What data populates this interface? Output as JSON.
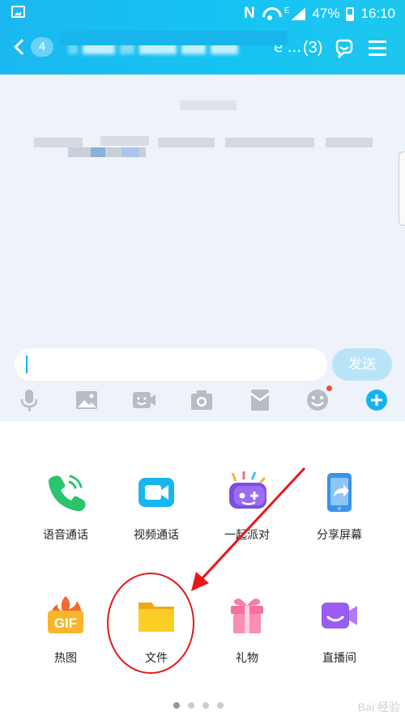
{
  "status_bar": {
    "battery": "47%",
    "time": "16:10",
    "network": "N",
    "signal_type": "E"
  },
  "header": {
    "back_count": "4",
    "title_suffix": "e ...",
    "member_count": "(3)"
  },
  "input": {
    "placeholder": "",
    "send_label": "发送"
  },
  "toolbar": {
    "icons": [
      "microphone-icon",
      "image-icon",
      "video-chat-icon",
      "camera-icon",
      "red-packet-icon",
      "emoji-icon",
      "plus-icon"
    ]
  },
  "panel": {
    "row1": [
      {
        "label": "语音通话",
        "icon": "phone-icon"
      },
      {
        "label": "视频通话",
        "icon": "video-call-icon"
      },
      {
        "label": "一起派对",
        "icon": "party-icon"
      },
      {
        "label": "分享屏幕",
        "icon": "screen-share-icon"
      }
    ],
    "row2": [
      {
        "label": "热图",
        "icon": "gif-icon"
      },
      {
        "label": "文件",
        "icon": "folder-icon"
      },
      {
        "label": "礼物",
        "icon": "gift-icon"
      },
      {
        "label": "直播间",
        "icon": "live-room-icon"
      }
    ],
    "page_indicator": {
      "pages": 4,
      "current": 1
    }
  },
  "colors": {
    "header_blue": "#16c4f2",
    "send_disabled": "#b9e4f7",
    "annotation_red": "#e51919"
  },
  "watermark": "Bai 经验"
}
